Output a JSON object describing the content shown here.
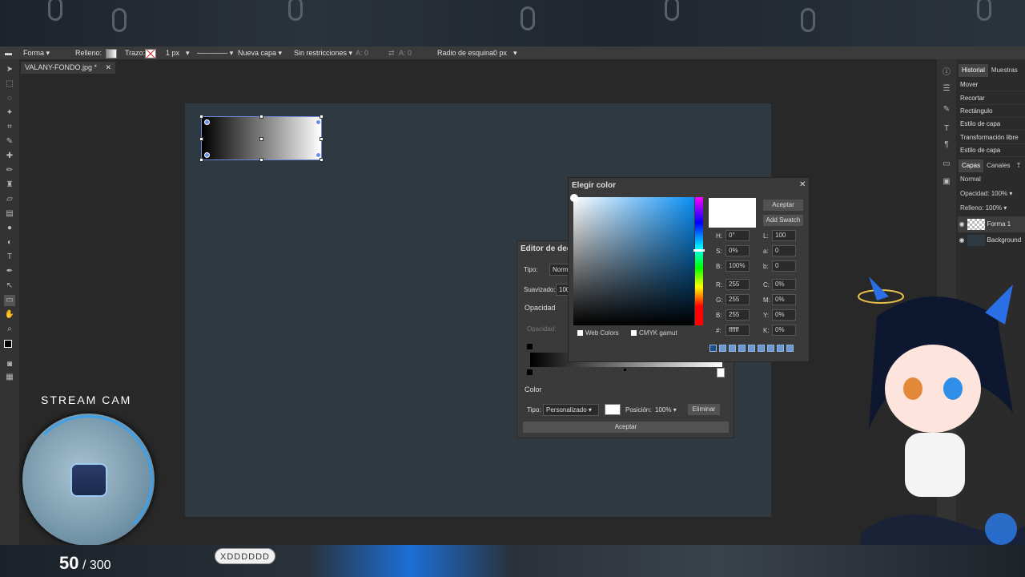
{
  "option_bar": {
    "shape_mode": "Forma",
    "fill_label": "Relleno:",
    "stroke_label": "Trazo:",
    "stroke_width": "1 px",
    "layer_mode": "Nueva capa",
    "constraint": "Sin restricciones",
    "a_label_1": "A:",
    "a_value_1": "0",
    "a_label_2": "A:",
    "a_value_2": "0",
    "corner_radius_label": "Radio de esquina:",
    "corner_radius_value": "0 px"
  },
  "document_tab": {
    "name": "VALANY-FONDO.jpg *"
  },
  "history_panel": {
    "tabs": [
      "Historial",
      "Muestras"
    ],
    "items": [
      "Mover",
      "Recortar",
      "Rectángulo",
      "Estilo de capa",
      "Transformación libre",
      "Estilo de capa"
    ]
  },
  "layers_panel": {
    "tabs": [
      "Capas",
      "Canales",
      "T"
    ],
    "blend_mode": "Normal",
    "opacity_label": "Opacidad:",
    "opacity_value": "100%",
    "fill_label": "Relleno:",
    "fill_value": "100%",
    "layers": [
      "Forma 1",
      "Background"
    ]
  },
  "gradient_editor": {
    "title": "Editor de deg",
    "type_label": "Tipo:",
    "type_value": "Norm",
    "smoothness_label": "Suavizado:",
    "smoothness_value": "100",
    "opacity_section": "Opacidad",
    "opacity_field_label": "Opacidad:",
    "color_section": "Color",
    "color_type_label": "Tipo:",
    "color_type_value": "Personalizado",
    "position_label": "Posición:",
    "position_value": "100%",
    "delete_button": "Eliminar",
    "accept_button": "Aceptar"
  },
  "color_picker": {
    "title": "Elegir color",
    "accept_button": "Aceptar",
    "add_swatch_button": "Add Swatch",
    "fields": {
      "H": "0°",
      "S": "0%",
      "Bv": "100%",
      "R": "255",
      "G": "255",
      "B": "255",
      "hex": "ffffff",
      "L": "100",
      "a": "0",
      "b": "0",
      "C": "0%",
      "M": "0%",
      "Y": "0%",
      "K": "0%"
    },
    "labels": {
      "H": "H:",
      "S": "S:",
      "Bv": "B:",
      "R": "R:",
      "G": "G:",
      "B": "B:",
      "hex": "#:",
      "L": "L:",
      "a": "a:",
      "b": "b:",
      "C": "C:",
      "M": "M:",
      "Y": "Y:",
      "K": "K:"
    },
    "web_colors_label": "Web Colors",
    "cmyk_gamut_label": "CMYK gamut",
    "selected_color": "#ffffff"
  },
  "stream_overlay": {
    "cam_label": "STREAM CAM",
    "count_current": "50",
    "count_total": "/ 300",
    "chat_bubble": "XDDDDDD"
  }
}
